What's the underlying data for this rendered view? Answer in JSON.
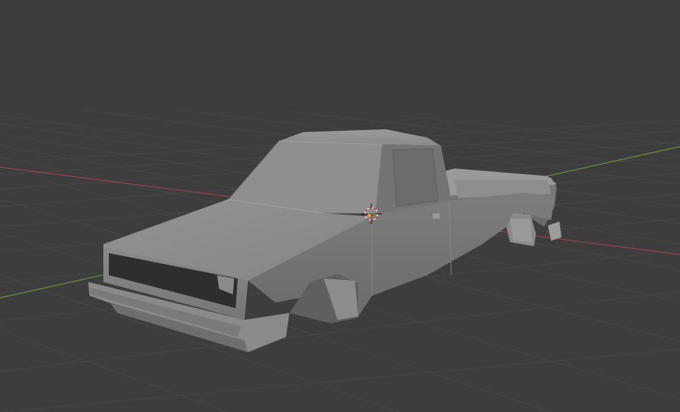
{
  "viewport": {
    "background_color": "#3d3d3d",
    "grid_color": "#4a4a4a",
    "x_axis_color": "#a0464b",
    "y_axis_color": "#6a9a3a",
    "cursor_icon": "3d-cursor-icon",
    "object": "car-body-mesh"
  }
}
